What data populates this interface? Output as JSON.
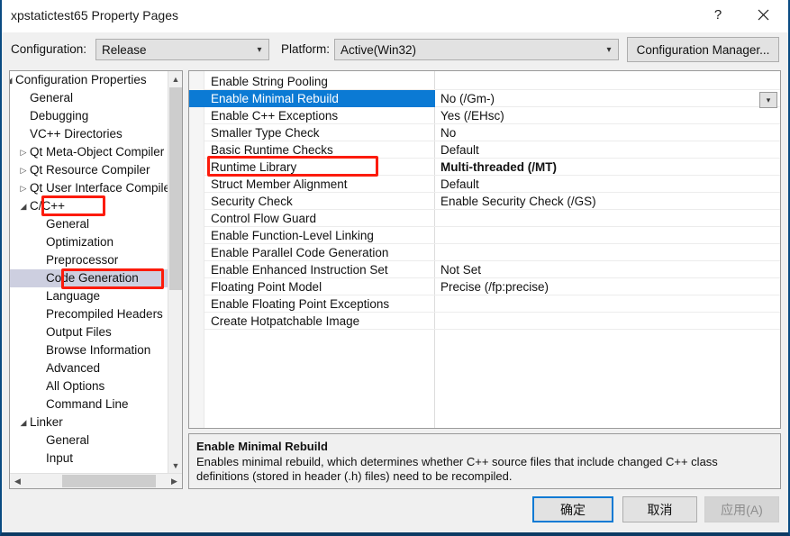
{
  "window": {
    "title": "xpstatictest65 Property Pages",
    "help_icon": "?",
    "close_icon": "close-icon"
  },
  "configbar": {
    "configuration_label": "Configuration:",
    "configuration_value": "Release",
    "platform_label": "Platform:",
    "platform_value": "Active(Win32)",
    "configuration_manager_label": "Configuration Manager..."
  },
  "tree": {
    "nodes": [
      {
        "label": "Configuration Properties",
        "indent": 1,
        "glyph": "expanded",
        "selected": false
      },
      {
        "label": "General",
        "indent": 2,
        "glyph": "none",
        "selected": false
      },
      {
        "label": "Debugging",
        "indent": 2,
        "glyph": "none",
        "selected": false
      },
      {
        "label": "VC++ Directories",
        "indent": 2,
        "glyph": "none",
        "selected": false
      },
      {
        "label": "Qt Meta-Object Compiler",
        "indent": 2,
        "glyph": "collapsed",
        "selected": false
      },
      {
        "label": "Qt Resource Compiler",
        "indent": 2,
        "glyph": "collapsed",
        "selected": false
      },
      {
        "label": "Qt User Interface Compiler",
        "indent": 2,
        "glyph": "collapsed",
        "selected": false
      },
      {
        "label": "C/C++",
        "indent": 2,
        "glyph": "expanded",
        "selected": false
      },
      {
        "label": "General",
        "indent": 3,
        "glyph": "none",
        "selected": false
      },
      {
        "label": "Optimization",
        "indent": 3,
        "glyph": "none",
        "selected": false
      },
      {
        "label": "Preprocessor",
        "indent": 3,
        "glyph": "none",
        "selected": false
      },
      {
        "label": "Code Generation",
        "indent": 3,
        "glyph": "none",
        "selected": true
      },
      {
        "label": "Language",
        "indent": 3,
        "glyph": "none",
        "selected": false
      },
      {
        "label": "Precompiled Headers",
        "indent": 3,
        "glyph": "none",
        "selected": false
      },
      {
        "label": "Output Files",
        "indent": 3,
        "glyph": "none",
        "selected": false
      },
      {
        "label": "Browse Information",
        "indent": 3,
        "glyph": "none",
        "selected": false
      },
      {
        "label": "Advanced",
        "indent": 3,
        "glyph": "none",
        "selected": false
      },
      {
        "label": "All Options",
        "indent": 3,
        "glyph": "none",
        "selected": false
      },
      {
        "label": "Command Line",
        "indent": 3,
        "glyph": "none",
        "selected": false
      },
      {
        "label": "Linker",
        "indent": 2,
        "glyph": "expanded",
        "selected": false
      },
      {
        "label": "General",
        "indent": 3,
        "glyph": "none",
        "selected": false
      },
      {
        "label": "Input",
        "indent": 3,
        "glyph": "none",
        "selected": false
      }
    ],
    "scroll_up_icon": "chevron-up-icon",
    "scroll_down_icon": "chevron-down-icon",
    "scroll_left_icon": "chevron-left-icon",
    "scroll_right_icon": "chevron-right-icon"
  },
  "grid": {
    "rows": [
      {
        "name": "Enable String Pooling",
        "value": "",
        "selected": false,
        "bold": false
      },
      {
        "name": "Enable Minimal Rebuild",
        "value": "No (/Gm-)",
        "selected": true,
        "bold": false
      },
      {
        "name": "Enable C++ Exceptions",
        "value": "Yes (/EHsc)",
        "selected": false,
        "bold": false
      },
      {
        "name": "Smaller Type Check",
        "value": "No",
        "selected": false,
        "bold": false
      },
      {
        "name": "Basic Runtime Checks",
        "value": "Default",
        "selected": false,
        "bold": false
      },
      {
        "name": "Runtime Library",
        "value": "Multi-threaded (/MT)",
        "selected": false,
        "bold": true
      },
      {
        "name": "Struct Member Alignment",
        "value": "Default",
        "selected": false,
        "bold": false
      },
      {
        "name": "Security Check",
        "value": "Enable Security Check (/GS)",
        "selected": false,
        "bold": false
      },
      {
        "name": "Control Flow Guard",
        "value": "",
        "selected": false,
        "bold": false
      },
      {
        "name": "Enable Function-Level Linking",
        "value": "",
        "selected": false,
        "bold": false
      },
      {
        "name": "Enable Parallel Code Generation",
        "value": "",
        "selected": false,
        "bold": false
      },
      {
        "name": "Enable Enhanced Instruction Set",
        "value": "Not Set",
        "selected": false,
        "bold": false
      },
      {
        "name": "Floating Point Model",
        "value": "Precise (/fp:precise)",
        "selected": false,
        "bold": false
      },
      {
        "name": "Enable Floating Point Exceptions",
        "value": "",
        "selected": false,
        "bold": false
      },
      {
        "name": "Create Hotpatchable Image",
        "value": "",
        "selected": false,
        "bold": false
      }
    ],
    "value_dropdown_icon": "chevron-down-icon"
  },
  "description": {
    "title": "Enable Minimal Rebuild",
    "body": "Enables minimal rebuild, which determines whether C++ source files that include changed C++ class definitions (stored in header (.h) files) need to be recompiled."
  },
  "footer": {
    "ok_label": "确定",
    "cancel_label": "取消",
    "apply_label": "应用(A)"
  },
  "annotations": [
    {
      "name": "cpp-node-highlight",
      "color": "#fc1b0b"
    },
    {
      "name": "code-generation-node-highlight",
      "color": "#fc1b0b"
    },
    {
      "name": "runtime-library-row-highlight",
      "color": "#fc1b0b"
    }
  ]
}
